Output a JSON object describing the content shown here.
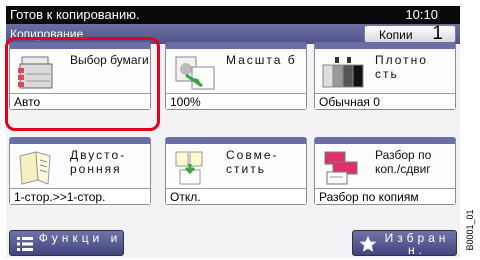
{
  "status_bar": {
    "message": "Готов к копированию.",
    "time": "10:10"
  },
  "header": {
    "title": "Копирование",
    "copies_label": "Копии",
    "copies_value": "1"
  },
  "tiles": [
    {
      "label": "Выбор бумаги",
      "value": "Авто",
      "icon": "paper-cassette-icon"
    },
    {
      "label": "Масшта б",
      "value": "100%",
      "icon": "zoom-icon"
    },
    {
      "label": "Плотно сть",
      "value": "Обычная 0",
      "icon": "density-icon"
    },
    {
      "label": "Двусто- ронняя",
      "value": "1-стор.>>1-стор.",
      "icon": "duplex-icon"
    },
    {
      "label": "Совме- стить",
      "value": "Откл.",
      "icon": "combine-icon"
    },
    {
      "label": "Разбор по коп./сдвиг",
      "value": "Разбор по копиям",
      "icon": "collate-icon"
    }
  ],
  "bottom": {
    "functions_label": "Функци и",
    "favorites_label": "Избран н."
  },
  "image_code": "B0001_01",
  "colors": {
    "highlight": "#e3001b",
    "accent": "#6a6ea6"
  }
}
